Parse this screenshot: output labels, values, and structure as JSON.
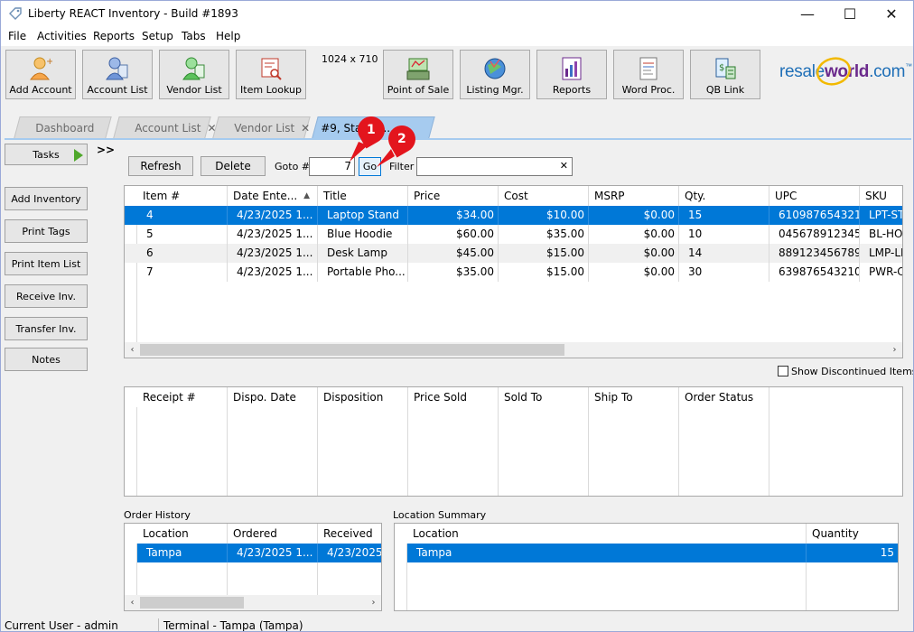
{
  "window": {
    "title": "Liberty REACT Inventory - Build #1893",
    "controls": {
      "minimize": "—",
      "maximize": "☐",
      "close": "✕"
    }
  },
  "menu": [
    "File",
    "Activities",
    "Reports",
    "Setup",
    "Tabs",
    "Help"
  ],
  "toolbar": {
    "resolution": "1024 x 710",
    "buttons": [
      {
        "label": "Add Account",
        "icon": "add-account-icon"
      },
      {
        "label": "Account List",
        "icon": "account-list-icon"
      },
      {
        "label": "Vendor List",
        "icon": "vendor-list-icon"
      },
      {
        "label": "Item Lookup",
        "icon": "item-lookup-icon"
      },
      {
        "label": "Point of Sale",
        "icon": "point-of-sale-icon"
      },
      {
        "label": "Listing Mgr.",
        "icon": "listing-manager-icon"
      },
      {
        "label": "Reports",
        "icon": "reports-icon"
      },
      {
        "label": "Word Proc.",
        "icon": "word-processor-icon"
      },
      {
        "label": "QB Link",
        "icon": "quickbooks-link-icon"
      }
    ],
    "logo": {
      "part1": "resale",
      "part2": "world",
      "part3": ".com",
      "tm": "™"
    }
  },
  "tabs": [
    {
      "label": "Dashboard",
      "closable": false,
      "active": false
    },
    {
      "label": "Account List",
      "closable": true,
      "active": false
    },
    {
      "label": "Vendor List",
      "closable": true,
      "active": false
    },
    {
      "label": "#9, State C...",
      "closable": false,
      "active": true
    }
  ],
  "left_panel": {
    "tasks_label": "Tasks",
    "collapse_glyph": ">>",
    "buttons": [
      "Add Inventory",
      "Print Tags",
      "Print Item List",
      "Receive Inv.",
      "Transfer Inv.",
      "Notes"
    ]
  },
  "actions": {
    "refresh": "Refresh",
    "delete": "Delete",
    "goto_label": "Goto #",
    "goto_value": "7",
    "go": "Go",
    "filter_label": "Filter",
    "filter_value": "",
    "filter_clear": "✕"
  },
  "callouts": [
    "1",
    "2"
  ],
  "items_grid": {
    "columns": [
      "Item #",
      "Date Ente...",
      "Title",
      "Price",
      "Cost",
      "MSRP",
      "Qty.",
      "UPC",
      "SKU"
    ],
    "sort_indicator": "▲",
    "rows": [
      [
        "4",
        "4/23/2025 1...",
        "Laptop Stand",
        "$34.00",
        "$10.00",
        "$0.00",
        "15",
        "610987654321",
        "LPT-ST"
      ],
      [
        "5",
        "4/23/2025 1...",
        "Blue Hoodie",
        "$60.00",
        "$35.00",
        "$0.00",
        "10",
        "045678912345",
        "BL-HO"
      ],
      [
        "6",
        "4/23/2025 1...",
        "Desk Lamp",
        "$45.00",
        "$15.00",
        "$0.00",
        "14",
        "889123456789",
        "LMP-LE"
      ],
      [
        "7",
        "4/23/2025 1...",
        "Portable Pho...",
        "$35.00",
        "$15.00",
        "$0.00",
        "30",
        "639876543210",
        "PWR-C"
      ]
    ],
    "selected_row": 0,
    "scroll_left": "‹",
    "scroll_right": "›"
  },
  "show_discontinued": {
    "label": "Show Discontinued Items",
    "checked": false
  },
  "dispo_grid": {
    "columns": [
      "Receipt #",
      "Dispo. Date",
      "Disposition",
      "Price Sold",
      "Sold To",
      "Ship To",
      "Order Status"
    ]
  },
  "order_history": {
    "title": "Order History",
    "columns": [
      "Location",
      "Ordered",
      "Received"
    ],
    "rows": [
      [
        "Tampa",
        "4/23/2025 1...",
        "4/23/2025"
      ]
    ]
  },
  "location_summary": {
    "title": "Location Summary",
    "columns": [
      "Location",
      "Quantity"
    ],
    "rows": [
      [
        "Tampa",
        "15"
      ]
    ]
  },
  "status": {
    "user": "Current User - admin",
    "terminal": "Terminal - Tampa (Tampa)"
  },
  "colors": {
    "selection": "#0078d7",
    "tab_active": "#a6cbef",
    "callout": "#e3151d",
    "tasks_arrow": "#4fa82b",
    "logo_blue": "#1f6fb7",
    "logo_purple": "#6b2a8c"
  }
}
